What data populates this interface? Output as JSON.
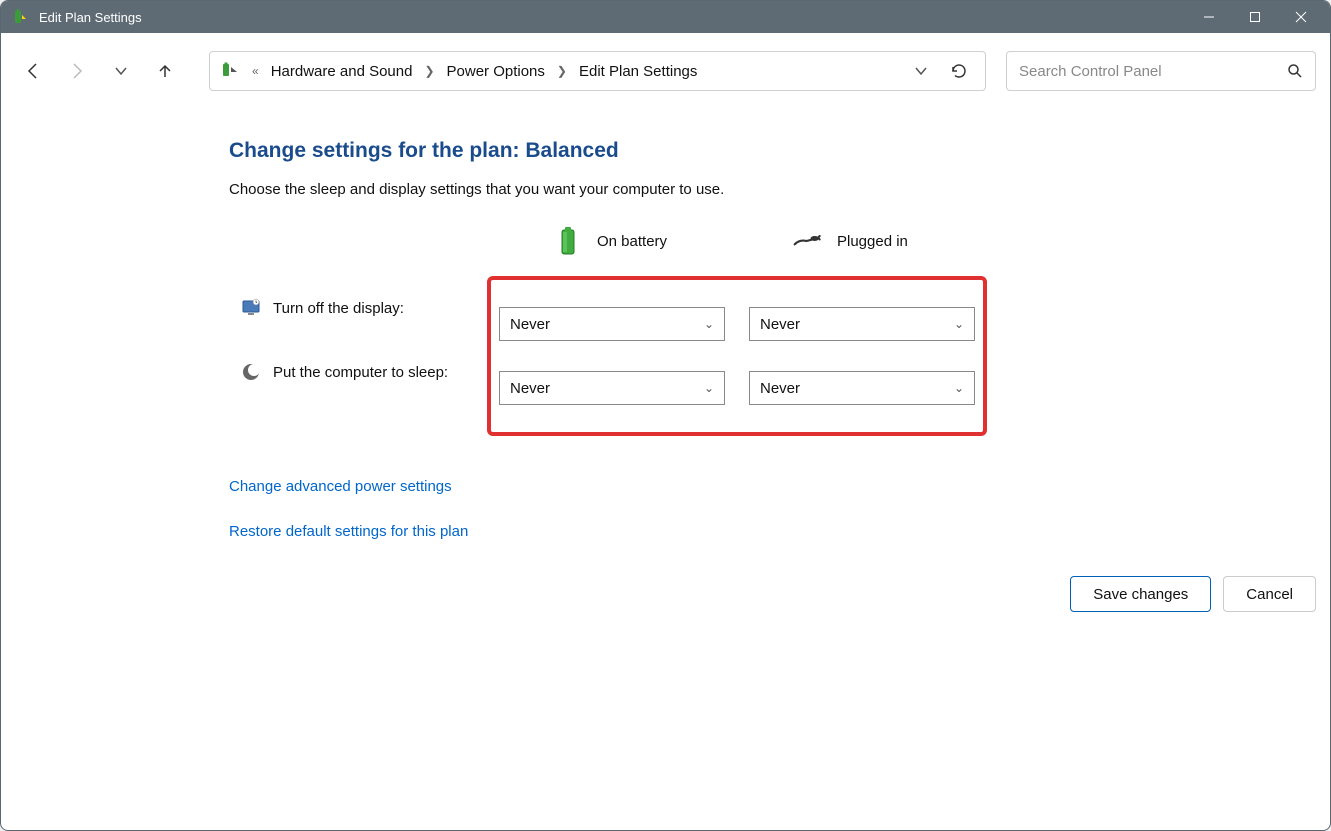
{
  "window": {
    "title": "Edit Plan Settings"
  },
  "breadcrumb": {
    "items": [
      "Hardware and Sound",
      "Power Options",
      "Edit Plan Settings"
    ]
  },
  "search": {
    "placeholder": "Search Control Panel"
  },
  "page": {
    "heading": "Change settings for the plan: Balanced",
    "subtext": "Choose the sleep and display settings that you want your computer to use.",
    "columns": {
      "battery": "On battery",
      "plugged": "Plugged in"
    },
    "rows": [
      {
        "label": "Turn off the display:",
        "battery_value": "Never",
        "plugged_value": "Never"
      },
      {
        "label": "Put the computer to sleep:",
        "battery_value": "Never",
        "plugged_value": "Never"
      }
    ],
    "links": {
      "advanced": "Change advanced power settings",
      "restore": "Restore default settings for this plan"
    },
    "buttons": {
      "save": "Save changes",
      "cancel": "Cancel"
    }
  }
}
